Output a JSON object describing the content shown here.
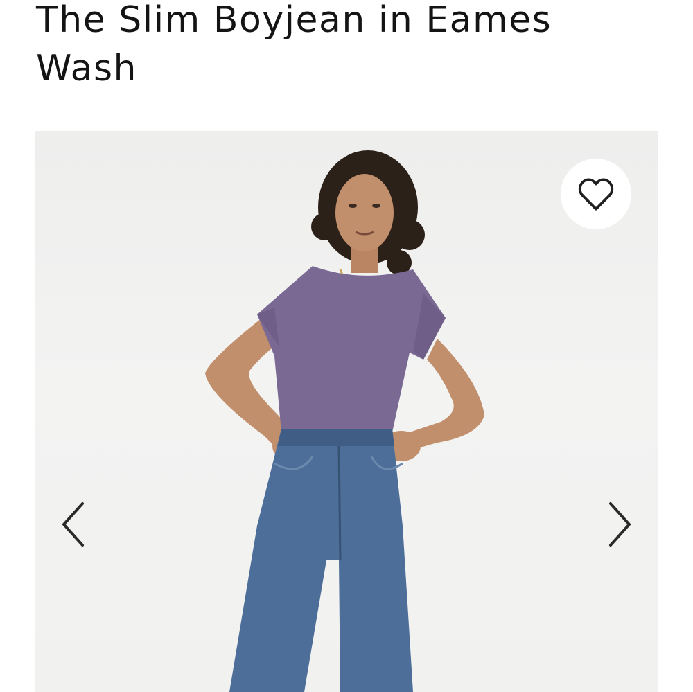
{
  "product": {
    "title": "The Slim Boyjean in Eames Wash"
  },
  "gallery": {
    "favorite_icon": "heart-outline-icon",
    "prev_icon": "chevron-left-icon",
    "next_icon": "chevron-right-icon",
    "colors": {
      "background": "#f1f1f0",
      "tshirt": "#7a6a93",
      "denim": "#4d6e98",
      "icon": "#1f1f1f"
    }
  }
}
